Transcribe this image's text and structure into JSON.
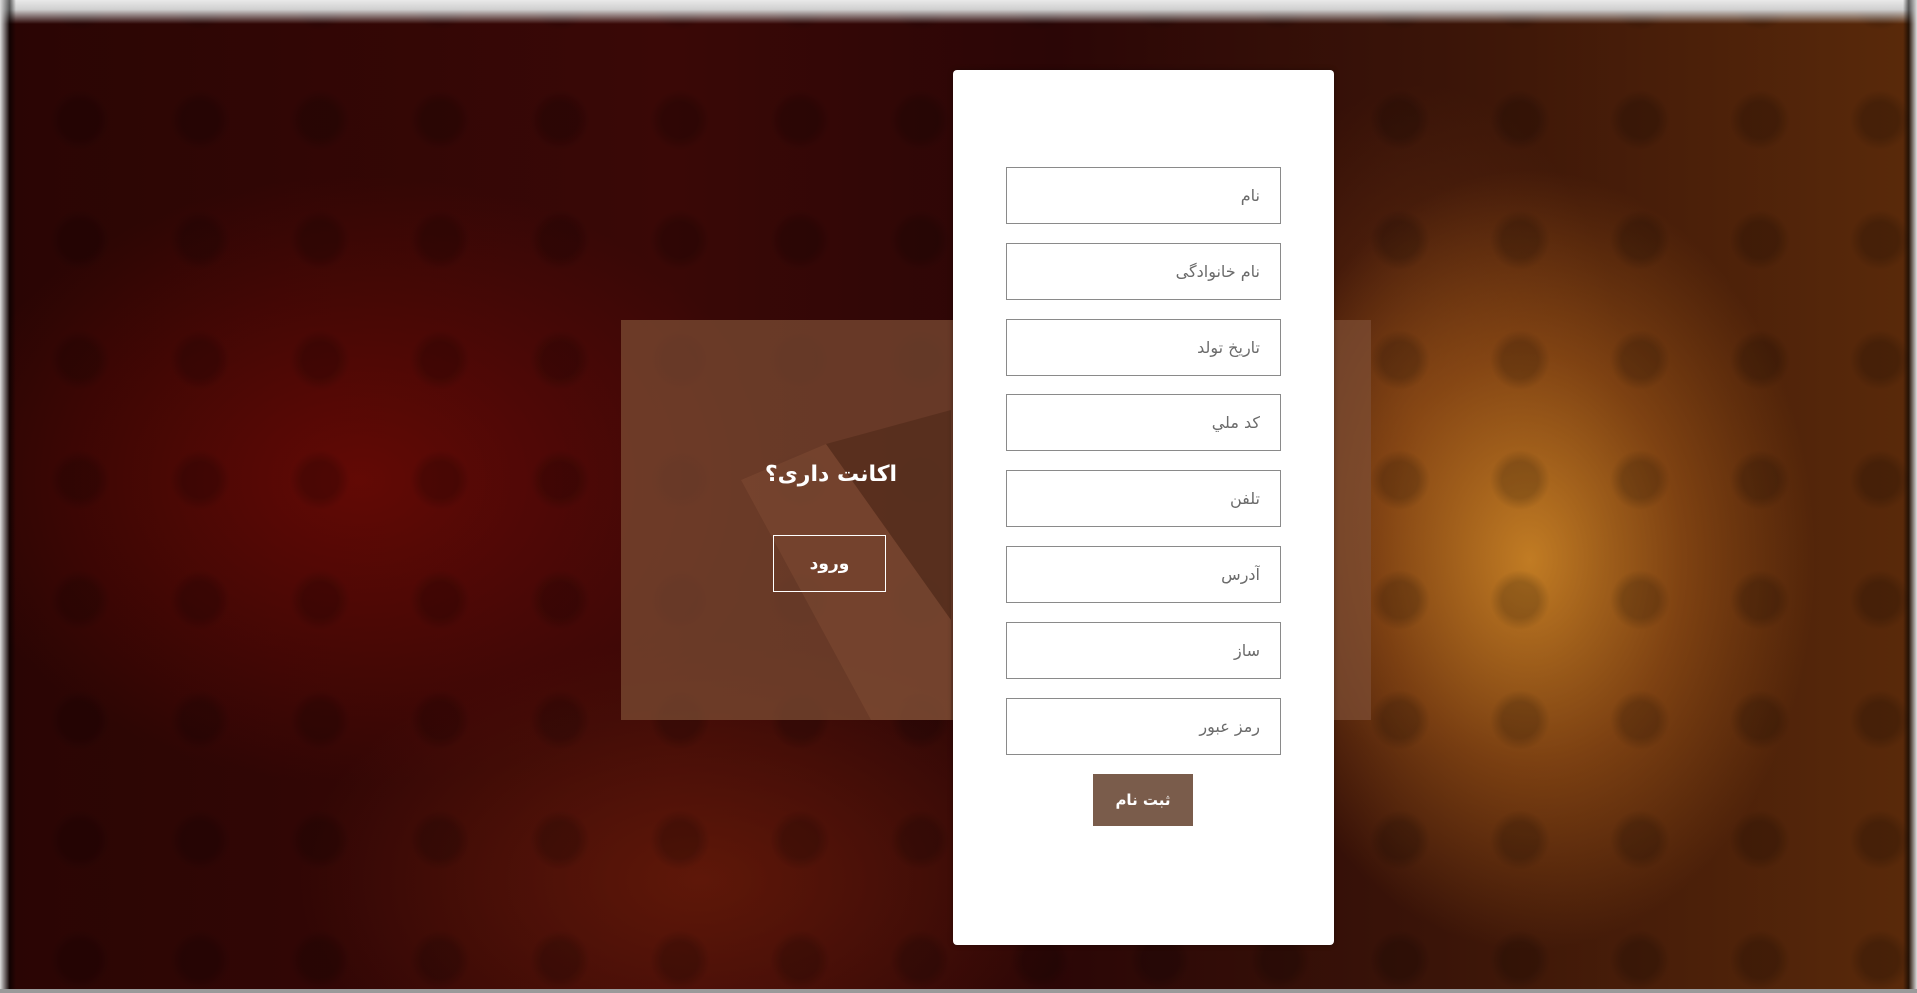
{
  "login_panel": {
    "title": "اکانت داری؟",
    "button_label": "ورود"
  },
  "register_form": {
    "fields": [
      {
        "placeholder": "نام",
        "value": ""
      },
      {
        "placeholder": "نام خانوادگی",
        "value": ""
      },
      {
        "placeholder": "تاریخ تولد",
        "value": ""
      },
      {
        "placeholder": "کد ملي",
        "value": ""
      },
      {
        "placeholder": "تلفن",
        "value": ""
      },
      {
        "placeholder": "آدرس",
        "value": ""
      },
      {
        "placeholder": "ساز",
        "value": ""
      },
      {
        "placeholder": "رمز عبور",
        "value": ""
      }
    ],
    "submit_label": "ثبت نام"
  },
  "colors": {
    "panel": "#7d4e34",
    "submit_button": "#7a5c4b",
    "card": "#ffffff"
  }
}
